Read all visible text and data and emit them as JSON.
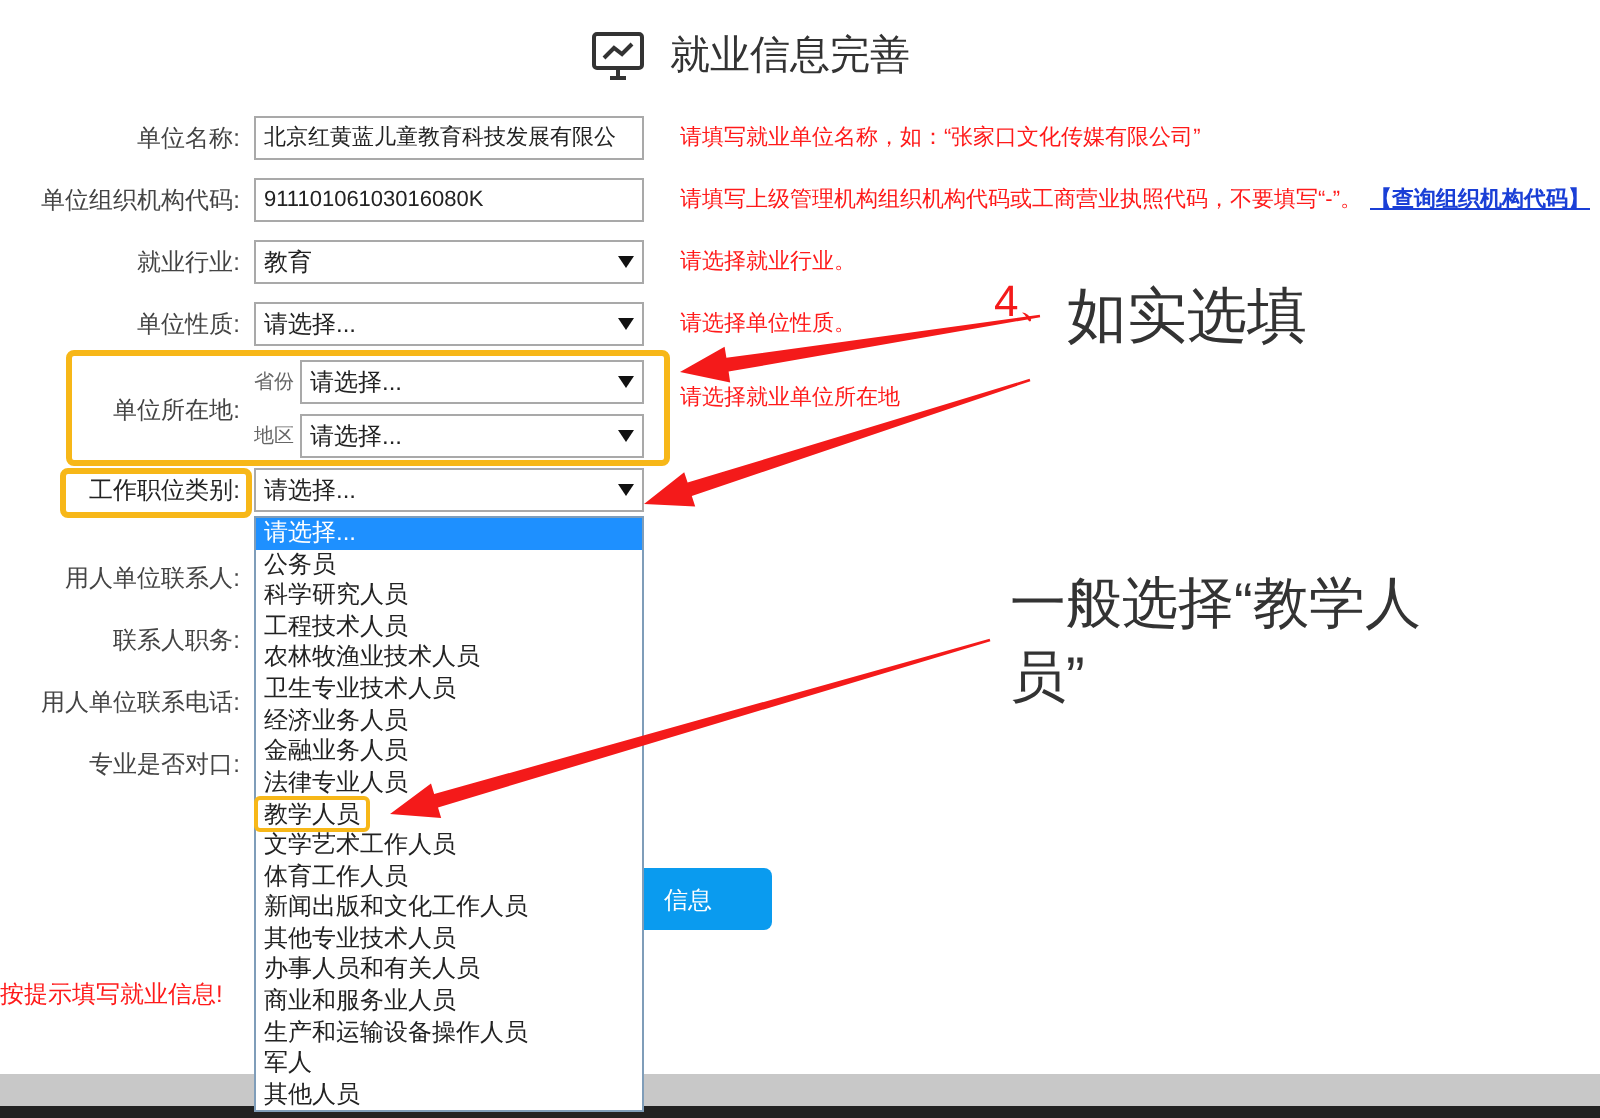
{
  "title": "就业信息完善",
  "fields": [
    {
      "kind": "input",
      "label": "单位名称:",
      "value": "北京红黄蓝儿童教育科技发展有限公",
      "hint": "请填写就业单位名称，如：“张家口文化传媒有限公司”"
    },
    {
      "kind": "input",
      "label": "单位组织机构代码:",
      "value": "91110106103016080K",
      "hint": "请填写上级管理机构组织机构代码或工商营业执照代码，不要填写“-”。",
      "link": "【查询组织机构代码】"
    },
    {
      "kind": "select",
      "label": "就业行业:",
      "value": "教育",
      "hint": "请选择就业行业。"
    },
    {
      "kind": "select",
      "label": "单位性质:",
      "value": "请选择...",
      "hint": "请选择单位性质。"
    }
  ],
  "location": {
    "label": "单位所在地:",
    "highlighted": true,
    "hint": "请选择就业单位所在地",
    "parts": [
      {
        "label": "省份",
        "value": "请选择..."
      },
      {
        "label": "地区",
        "value": "请选择..."
      }
    ]
  },
  "job_category": {
    "label": "工作职位类别:",
    "highlighted": true,
    "value": "请选择...",
    "options": [
      {
        "label": "请选择...",
        "selected": true,
        "highlighted": false
      },
      {
        "label": "公务员",
        "selected": false,
        "highlighted": false
      },
      {
        "label": "科学研究人员",
        "selected": false,
        "highlighted": false
      },
      {
        "label": "工程技术人员",
        "selected": false,
        "highlighted": false
      },
      {
        "label": "农林牧渔业技术人员",
        "selected": false,
        "highlighted": false
      },
      {
        "label": "卫生专业技术人员",
        "selected": false,
        "highlighted": false
      },
      {
        "label": "经济业务人员",
        "selected": false,
        "highlighted": false
      },
      {
        "label": "金融业务人员",
        "selected": false,
        "highlighted": false
      },
      {
        "label": "法律专业人员",
        "selected": false,
        "highlighted": false
      },
      {
        "label": "教学人员",
        "selected": false,
        "highlighted": true
      },
      {
        "label": "文学艺术工作人员",
        "selected": false,
        "highlighted": false
      },
      {
        "label": "体育工作人员",
        "selected": false,
        "highlighted": false
      },
      {
        "label": "新闻出版和文化工作人员",
        "selected": false,
        "highlighted": false
      },
      {
        "label": "其他专业技术人员",
        "selected": false,
        "highlighted": false
      },
      {
        "label": "办事人员和有关人员",
        "selected": false,
        "highlighted": false
      },
      {
        "label": "商业和服务业人员",
        "selected": false,
        "highlighted": false
      },
      {
        "label": "生产和运输设备操作人员",
        "selected": false,
        "highlighted": false
      },
      {
        "label": "军人",
        "selected": false,
        "highlighted": false
      },
      {
        "label": "其他人员",
        "selected": false,
        "highlighted": false
      }
    ]
  },
  "other_labels": [
    "用人单位联系人:",
    "联系人职务:",
    "用人单位联系电话:",
    "专业是否对口:"
  ],
  "submit_button": "信息",
  "error_message": "按提示填写就业信息!",
  "annotations": [
    {
      "number": "4、",
      "text": "如实选填"
    },
    {
      "text": "一般选择“教学人员”"
    }
  ]
}
